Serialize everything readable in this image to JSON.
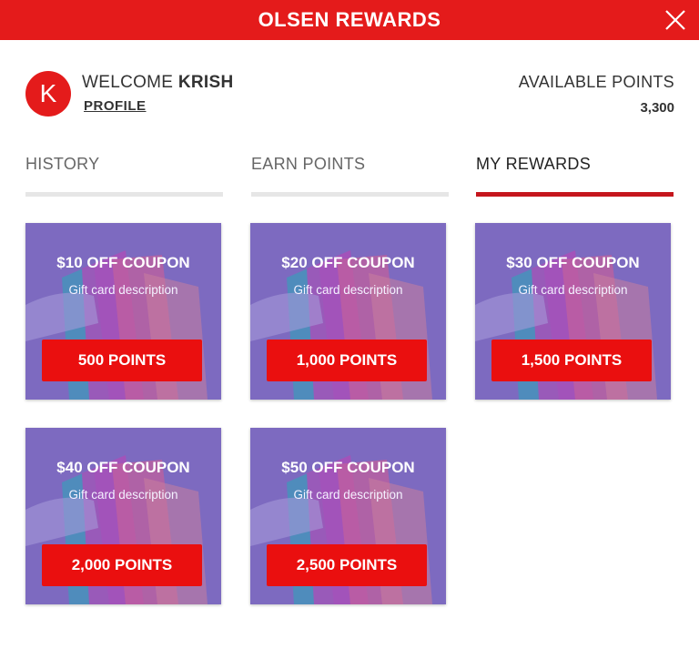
{
  "header": {
    "title": "OLSEN REWARDS"
  },
  "user": {
    "avatar_letter": "K",
    "welcome_prefix": "WELCOME",
    "name": "KRISH",
    "profile_link": "PROFILE"
  },
  "points": {
    "label": "AVAILABLE POINTS",
    "value": "3,300"
  },
  "tabs": [
    {
      "label": "HISTORY",
      "active": false
    },
    {
      "label": "EARN POINTS",
      "active": false
    },
    {
      "label": "MY REWARDS",
      "active": true
    }
  ],
  "rewards": [
    {
      "title": "$10 OFF COUPON",
      "description": "Gift card description",
      "button": "500 POINTS"
    },
    {
      "title": "$20 OFF COUPON",
      "description": "Gift card description",
      "button": "1,000 POINTS"
    },
    {
      "title": "$30 OFF COUPON",
      "description": "Gift card description",
      "button": "1,500 POINTS"
    },
    {
      "title": "$40 OFF COUPON",
      "description": "Gift card description",
      "button": "2,000 POINTS"
    },
    {
      "title": "$50 OFF COUPON",
      "description": "Gift card description",
      "button": "2,500 POINTS"
    }
  ],
  "colors": {
    "brand_red": "#e41b1b",
    "active_tab": "#c5161d",
    "card_purple": "#7d6bc0",
    "button_red": "#ea0f0f"
  }
}
